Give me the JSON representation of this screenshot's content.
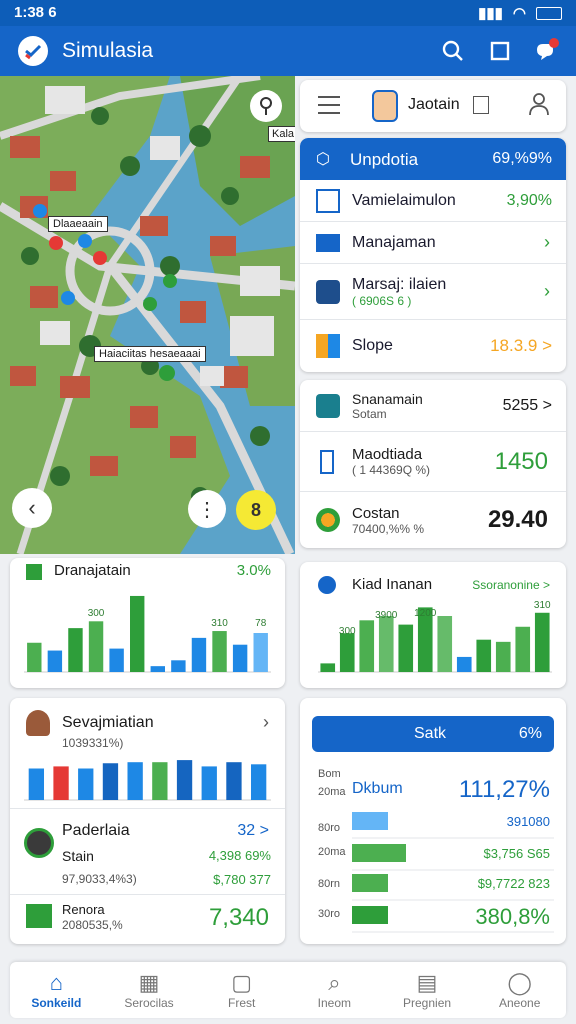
{
  "status": {
    "time": "1:38 6"
  },
  "appbar": {
    "title": "Simulasia"
  },
  "map": {
    "labels": [
      "Dlaaeaain",
      "Haiaciitas hesaeaaai",
      "Kala"
    ]
  },
  "account_card": {
    "name": "Jaotain"
  },
  "menu": {
    "header_label": "Unpdotia",
    "header_value": "69,%9%",
    "items": [
      {
        "label": "Vamielaimulon",
        "value": "3,90%",
        "icon": "grid-icon"
      },
      {
        "label": "Manajaman",
        "value": "",
        "icon": "list-icon"
      },
      {
        "label": "Marsaj: ilaien",
        "sub": "( 6906S 6 )",
        "value": "",
        "icon": "truck-icon"
      },
      {
        "label": "Slope",
        "value": "18.3.9 >",
        "icon": "book-icon"
      }
    ]
  },
  "stats_card": {
    "items": [
      {
        "label": "Snanamain",
        "sub": "Sotam",
        "value": "5255 >"
      },
      {
        "label": "Maodtiada",
        "sub": "( 1 44369Q %)",
        "value": "1450"
      },
      {
        "label": "Costan",
        "sub": "70400,%% %",
        "value": "29.40"
      }
    ]
  },
  "chart1": {
    "title": "Dranajatain",
    "value": "3.0%",
    "chart_data": {
      "type": "bar",
      "labels": [
        "300",
        "310",
        "78"
      ],
      "values": [
        30,
        22,
        45,
        52,
        24,
        78,
        6,
        12,
        35,
        42,
        28,
        40
      ],
      "colors": [
        "#4caf50",
        "#1e88e5",
        "#2e9e3a",
        "#4caf50",
        "#1e88e5",
        "#2e9e3a",
        "#1e88e5",
        "#1e88e5",
        "#1e88e5",
        "#4caf50",
        "#1e88e5",
        "#64b5f6"
      ]
    }
  },
  "chart2": {
    "title": "Kiad Inanan",
    "value": "Ssoranonine >",
    "chart_data": {
      "type": "bar",
      "labels": [
        "300",
        "3900",
        "1200",
        "310"
      ],
      "values": [
        8,
        36,
        48,
        52,
        44,
        60,
        52,
        14,
        30,
        28,
        42,
        55
      ],
      "colors": [
        "#2e9e3a",
        "#2e9e3a",
        "#4caf50",
        "#66bb6a",
        "#2e9e3a",
        "#2e9e3a",
        "#66bb6a",
        "#1e88e5",
        "#2e9e3a",
        "#4caf50",
        "#4caf50",
        "#2e9e3a"
      ]
    }
  },
  "chart3": {
    "title": "Sevajmiatian",
    "sub": "1039331%)",
    "chart_data": {
      "type": "bar",
      "values": [
        30,
        32,
        30,
        35,
        36,
        36,
        38,
        32,
        36,
        34
      ],
      "colors": [
        "#1e88e5",
        "#e53935",
        "#1e88e5",
        "#1565c0",
        "#1e88e5",
        "#4caf50",
        "#1565c0",
        "#1e88e5",
        "#1565c0",
        "#1e88e5"
      ]
    }
  },
  "bottom_left": {
    "items": [
      {
        "label": "Paderlaia",
        "sub": "Stain",
        "sub2": "97,9033,4%3)",
        "value": "32 >",
        "v2": "4,398 69%",
        "v3": "$,780 377"
      },
      {
        "label": "Renora",
        "sub": "2080535,%",
        "value": "7,340"
      }
    ]
  },
  "sidebar_card": {
    "header": "Satk",
    "header_value": "6%",
    "title": "Dkbum",
    "title_value": "111,27%",
    "y_labels": [
      "Bom",
      "20ma",
      "80ro",
      "20ma",
      "80rn",
      "30ro"
    ],
    "chart_data": {
      "type": "bar",
      "values": [
        60,
        90,
        60,
        60
      ],
      "colors": [
        "#64b5f6",
        "#4caf50",
        "#4caf50",
        "#2e9e3a"
      ]
    },
    "values": [
      "391080",
      "$3,756 S65",
      "$9,7722 823",
      "380,8%"
    ]
  },
  "nav": {
    "items": [
      {
        "label": "Sonkeild",
        "icon": "home-icon",
        "active": true
      },
      {
        "label": "Serocilas",
        "icon": "building-icon",
        "active": false
      },
      {
        "label": "Frest",
        "icon": "bag-icon",
        "active": false
      },
      {
        "label": "Ineom",
        "icon": "search-icon",
        "active": false
      },
      {
        "label": "Pregnien",
        "icon": "card-icon",
        "active": false
      },
      {
        "label": "Aneone",
        "icon": "person-icon",
        "active": false
      }
    ]
  }
}
